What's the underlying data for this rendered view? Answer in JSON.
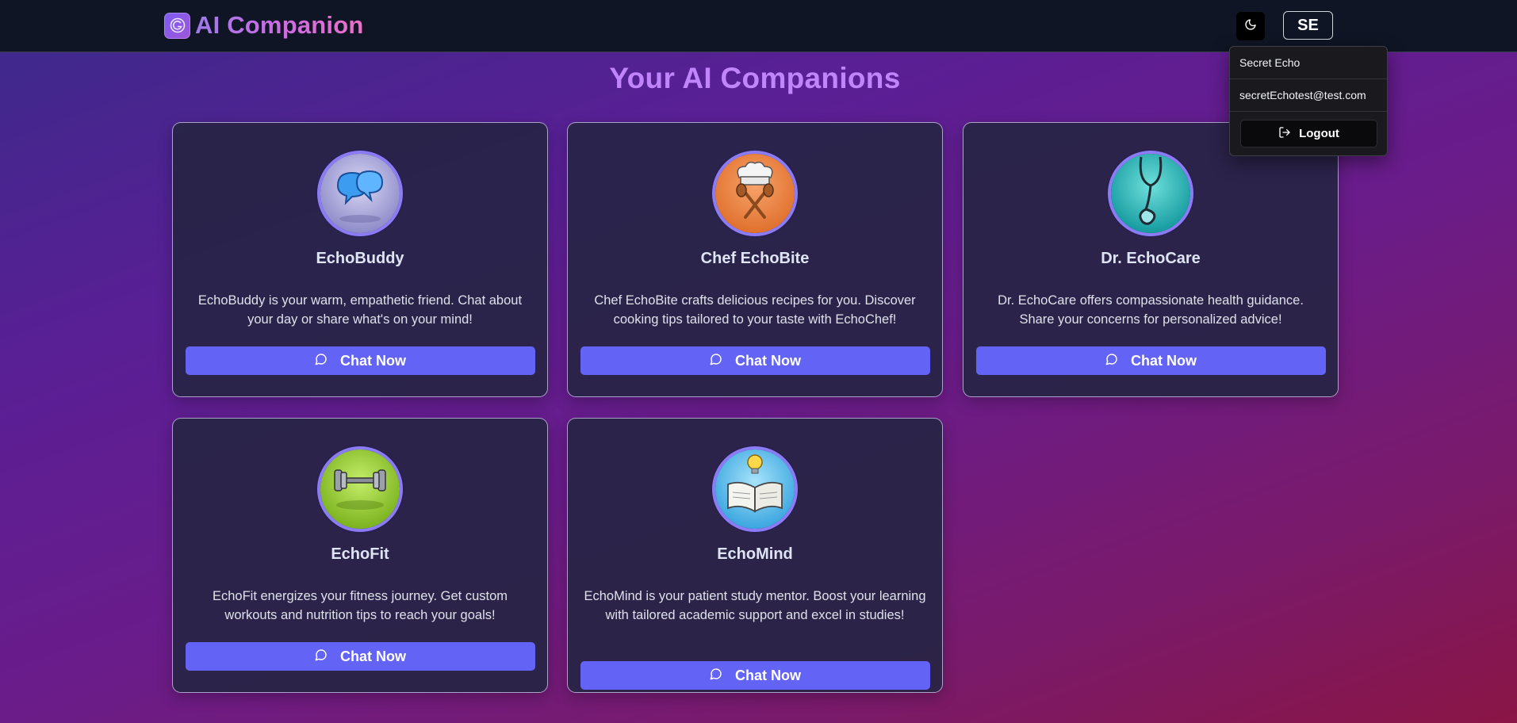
{
  "header": {
    "app_title": "AI Companion",
    "logo_icon": "app-logo-icon",
    "theme_icon": "moon-icon",
    "avatar_initials": "SE"
  },
  "user_menu": {
    "name": "Secret Echo",
    "email": "secretEchotest@test.com",
    "logout_label": "Logout",
    "logout_icon": "logout-icon"
  },
  "main": {
    "title": "Your AI Companions",
    "chat_icon": "chat-bubble-icon",
    "cards": [
      {
        "name": "EchoBuddy",
        "description": "EchoBuddy is your warm, empathetic friend. Chat about your day or share what's on your mind!",
        "button_label": "Chat Now",
        "avatar_icon": "speech-bubbles-icon",
        "avatar_color": "#b8b6e6"
      },
      {
        "name": "Chef EchoBite",
        "description": "Chef EchoBite crafts delicious recipes for you. Discover cooking tips tailored to your taste with EchoChef!",
        "button_label": "Chat Now",
        "avatar_icon": "chef-hat-icon",
        "avatar_color": "#f08a4b"
      },
      {
        "name": "Dr. EchoCare",
        "description": "Dr. EchoCare offers compassionate health guidance. Share your concerns for personalized advice!",
        "button_label": "Chat Now",
        "avatar_icon": "stethoscope-icon",
        "avatar_color": "#2fbcc0"
      },
      {
        "name": "EchoFit",
        "description": "EchoFit energizes your fitness journey. Get custom workouts and nutrition tips to reach your goals!",
        "button_label": "Chat Now",
        "avatar_icon": "dumbbell-icon",
        "avatar_color": "#9bd13c"
      },
      {
        "name": "EchoMind",
        "description": "EchoMind is your patient study mentor. Boost your learning with tailored academic support and excel in studies!",
        "button_label": "Chat Now",
        "avatar_icon": "book-lightbulb-icon",
        "avatar_color": "#5ec3ef"
      }
    ]
  }
}
